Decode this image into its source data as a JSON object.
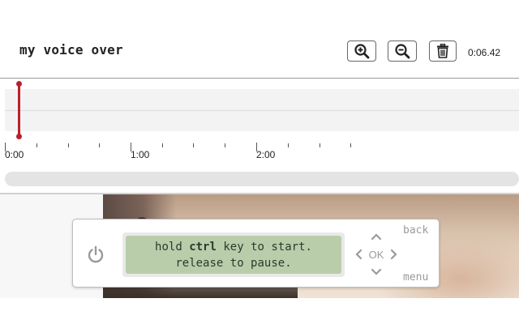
{
  "project": {
    "title": "my voice over"
  },
  "toolbar": {
    "zoom_in_icon": "zoom-in-icon",
    "zoom_out_icon": "zoom-out-icon",
    "delete_icon": "trash-icon",
    "duration": "0:06.42"
  },
  "timeline": {
    "playhead_position": "0:00",
    "ruler_labels": [
      "0:00",
      "1:00",
      "2:00"
    ],
    "playhead_color": "#b8212d"
  },
  "recorder": {
    "power_icon": "power-icon",
    "screen_line1_pre": "hold ",
    "screen_line1_key": "ctrl",
    "screen_line1_post": " key to start.",
    "screen_line2": "release to pause.",
    "ok_label": "OK",
    "back_label": "back",
    "menu_label": "menu",
    "screen_color": "#b9cdab"
  }
}
